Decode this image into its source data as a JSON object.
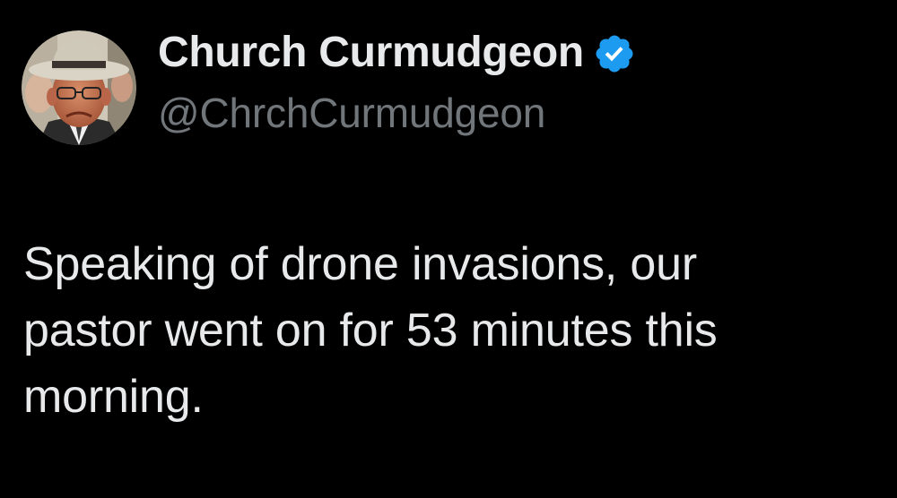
{
  "author": {
    "display_name": "Church Curmudgeon",
    "handle": "@ChrchCurmudgeon",
    "verified": true,
    "verified_icon": "verified-badge-icon",
    "avatar": "avatar-photo"
  },
  "tweet": {
    "lines": [
      "Speaking of drone invasions, our",
      "pastor went on for 53 minutes this",
      "morning."
    ]
  },
  "colors": {
    "background": "#000000",
    "text_primary": "#e7e9ea",
    "text_secondary": "#71767b",
    "verified_blue": "#1d9bf0"
  }
}
